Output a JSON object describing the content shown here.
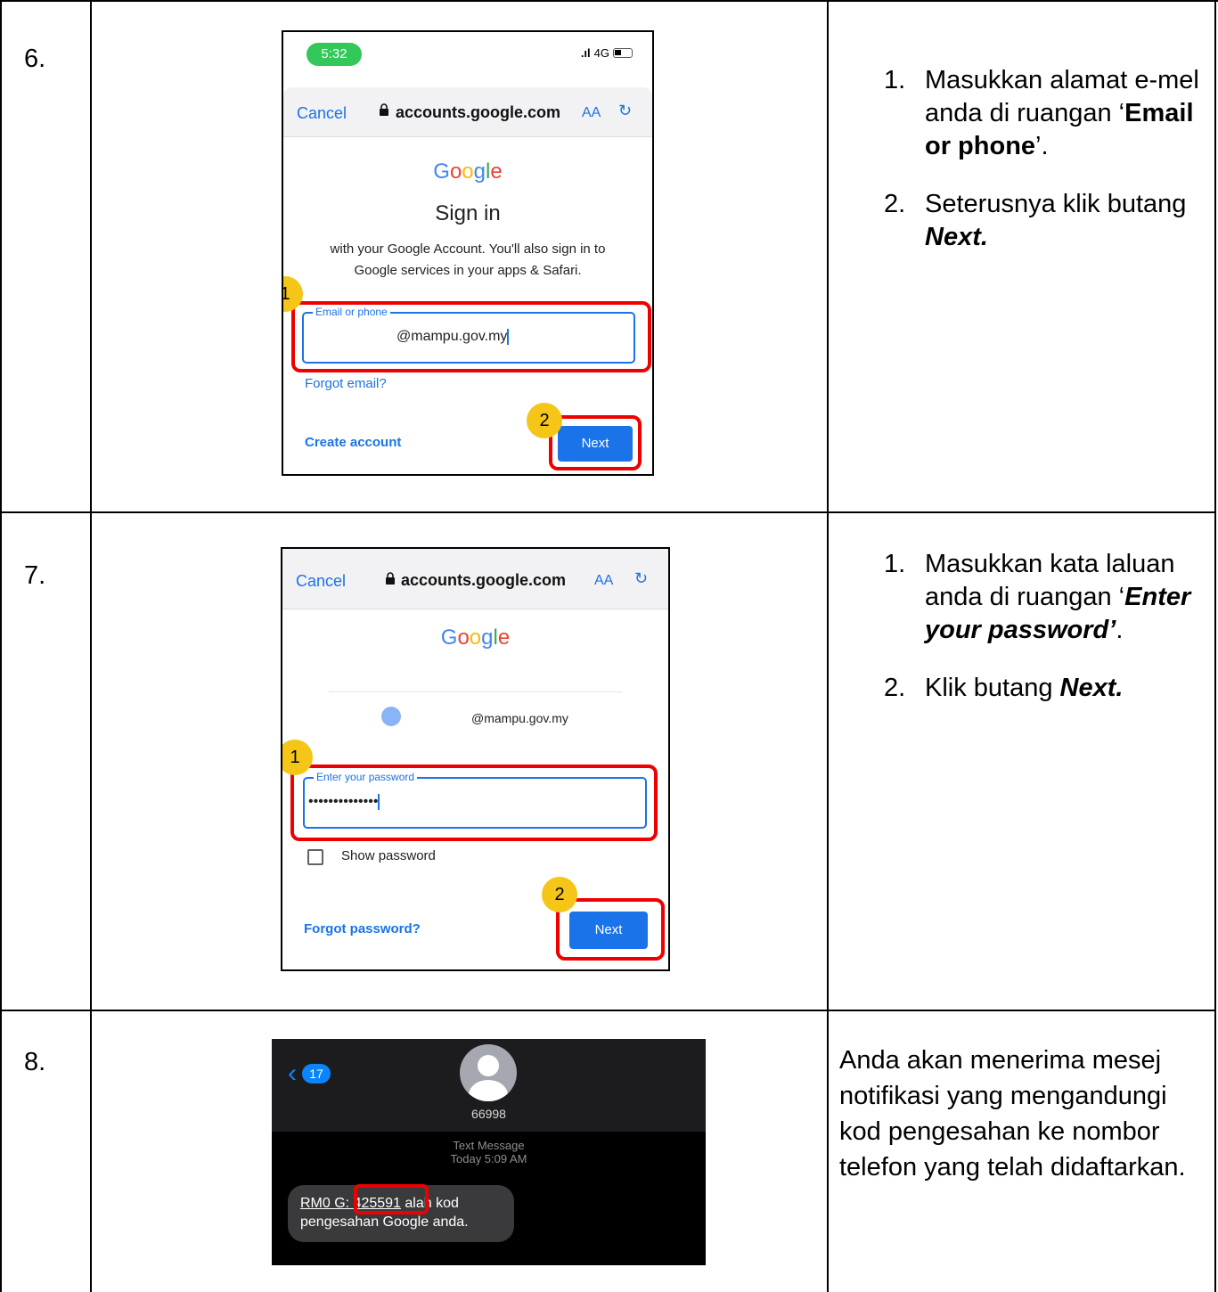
{
  "rows": [
    {
      "number": "6.",
      "instructions": [
        {
          "n": "1.",
          "parts": [
            "Masukkan alamat e-mel anda di ruangan ‘",
            "Email or phone",
            "’."
          ]
        },
        {
          "n": "2.",
          "parts": [
            "Seterusnya klik butang ",
            "Next."
          ]
        }
      ],
      "screen": {
        "time": "5:32",
        "signal": "4G",
        "cancel": "Cancel",
        "host": "accounts.google.com",
        "aa": "AA",
        "logo": "Google",
        "title": "Sign in",
        "subtitle_line1": "with your Google Account. You'll also sign in to",
        "subtitle_line2": "Google services in your apps & Safari.",
        "field_label": "Email or phone",
        "field_value": "@mampu.gov.my",
        "forgot": "Forgot email?",
        "create": "Create account",
        "next": "Next",
        "badge1": "1",
        "badge2": "2"
      }
    },
    {
      "number": "7.",
      "instructions": [
        {
          "n": "1.",
          "parts": [
            "Masukkan kata laluan anda di ruangan ‘",
            "Enter your password’",
            "."
          ]
        },
        {
          "n": "2.",
          "parts": [
            "Klik butang ",
            "Next."
          ]
        }
      ],
      "screen": {
        "cancel": "Cancel",
        "host": "accounts.google.com",
        "aa": "AA",
        "logo": "Google",
        "account": "@mampu.gov.my",
        "field_label": "Enter your password",
        "field_value": "••••••••••••••",
        "show_password": "Show password",
        "forgot": "Forgot password?",
        "next": "Next",
        "badge1": "1",
        "badge2": "2"
      }
    },
    {
      "number": "8.",
      "text": "Anda akan menerima mesej notifikasi yang mengandungi kod pengesahan ke nombor telefon yang telah didaftarkan.",
      "screen": {
        "back_count": "17",
        "sender": "66998",
        "msg_type": "Text Message",
        "msg_time": "Today 5:09 AM",
        "msg_prefix": "RM0 G: ",
        "code": "425591",
        "msg_suffix": " alah kod",
        "msg_line2": "pengesahan Google anda."
      }
    }
  ],
  "colors": {
    "google_blue": "#4285F4",
    "google_red": "#EA4335",
    "google_yellow": "#FBBC05",
    "google_green": "#34A853",
    "highlight_red": "#e00000",
    "badge_yellow": "#f5c518"
  }
}
